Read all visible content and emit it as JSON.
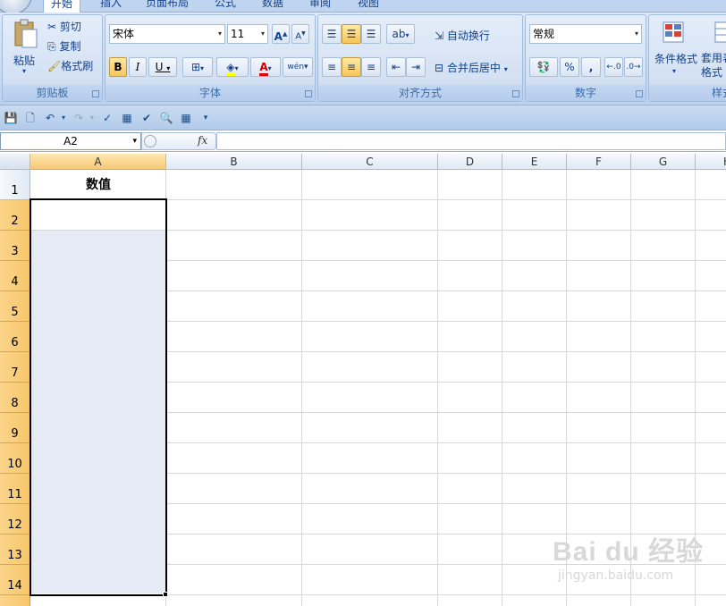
{
  "tabs": [
    "开始",
    "插入",
    "页面布局",
    "公式",
    "数据",
    "审阅",
    "视图"
  ],
  "clipboard": {
    "paste": "粘贴",
    "cut": "剪切",
    "copy": "复制",
    "format_painter": "格式刷",
    "group": "剪贴板"
  },
  "font": {
    "name": "宋体",
    "size": "11",
    "bold": "B",
    "italic": "I",
    "underline": "U",
    "color_letter": "A",
    "group": "字体",
    "phonetic": "wén"
  },
  "alignment": {
    "wrap": "自动换行",
    "merge": "合并后居中",
    "group": "对齐方式"
  },
  "number": {
    "format": "常规",
    "percent": "%",
    "comma": ",",
    "group": "数字"
  },
  "styles": {
    "conditional": "条件格式",
    "table": "套用表格格式",
    "group": "样式"
  },
  "formula_bar": {
    "name_box": "A2",
    "fx": "fx",
    "value": ""
  },
  "columns": [
    "A",
    "B",
    "C",
    "D",
    "E",
    "F",
    "G",
    "H"
  ],
  "rows": [
    "1",
    "2",
    "3",
    "4",
    "5",
    "6",
    "7",
    "8",
    "9",
    "10",
    "11",
    "12",
    "13",
    "14"
  ],
  "cells": {
    "A1": "数值"
  },
  "watermark": {
    "logo": "Bai du 经验",
    "url": "jingyan.baidu.com"
  }
}
